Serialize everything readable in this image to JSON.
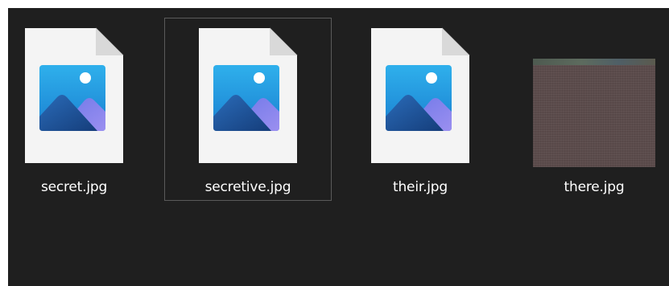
{
  "files": [
    {
      "name": "secret.jpg",
      "icon": "image-file-icon",
      "selected": false
    },
    {
      "name": "secretive.jpg",
      "icon": "image-file-icon",
      "selected": true
    },
    {
      "name": "their.jpg",
      "icon": "image-file-icon",
      "selected": false
    },
    {
      "name": "there.jpg",
      "icon": "image-thumbnail",
      "selected": false
    }
  ],
  "colors": {
    "background": "#1f1f1f",
    "selection_border": "#5a5a5a",
    "label_text": "#ffffff",
    "page_fill": "#f3f3f3",
    "mountain_dark": "#1e4f8f",
    "sky_blue": "#2aa6e8"
  }
}
